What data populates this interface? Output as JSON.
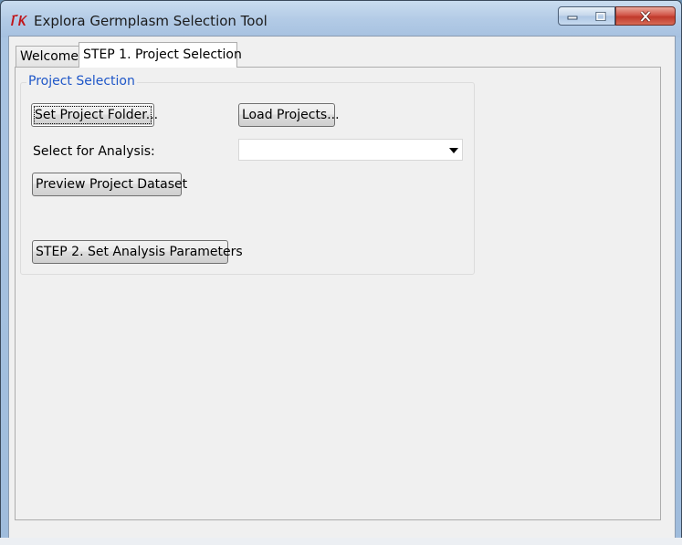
{
  "window": {
    "title": "Explora Germplasm Selection Tool",
    "icon": "tk-feather-icon"
  },
  "title_controls": {
    "minimize": "minimize-icon",
    "maximize": "maximize-icon",
    "close": "close-icon"
  },
  "tabs": [
    {
      "label": "Welcome",
      "active": false
    },
    {
      "label": "STEP 1. Project Selection",
      "active": true
    }
  ],
  "group": {
    "title": "Project Selection"
  },
  "buttons": {
    "set_project_folder": "Set Project Folder...",
    "load_projects": "Load Projects...",
    "preview_dataset": "Preview Project Dataset",
    "step2": "STEP 2. Set Analysis Parameters"
  },
  "analysis": {
    "label": "Select for Analysis:",
    "selected_value": ""
  },
  "colors": {
    "group_title": "#1f57c8",
    "close_button": "#c0392b"
  }
}
